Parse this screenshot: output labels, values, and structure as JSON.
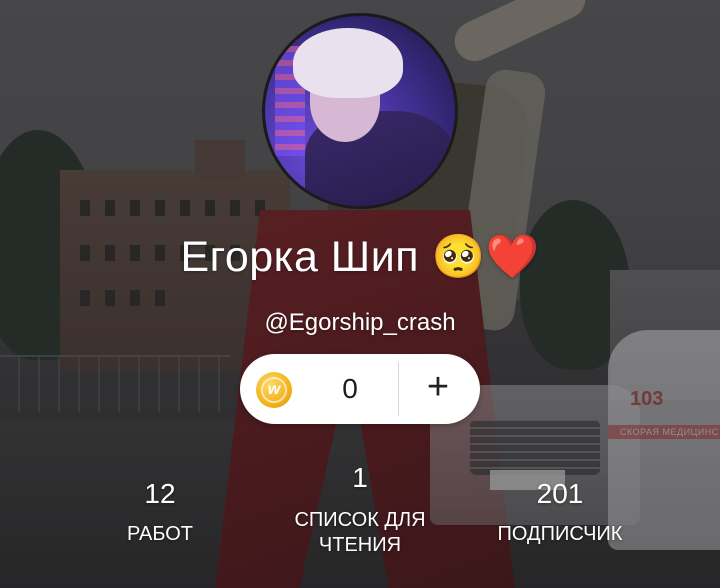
{
  "profile": {
    "display_name": "Егорка Шип 🥺❤️",
    "handle": "@Egorship_crash"
  },
  "coins": {
    "icon": "wattpad-coin-icon",
    "icon_letter": "w",
    "count": "0",
    "add_label": "+"
  },
  "stats": {
    "works": {
      "value": "12",
      "label": "РАБОТ"
    },
    "reading_lists": {
      "value": "1",
      "label": "СПИСОК ДЛЯ ЧТЕНИЯ"
    },
    "followers": {
      "value": "201",
      "label": "ПОДПИСЧИК"
    }
  },
  "background": {
    "ambulance_number": "103",
    "ambulance_text": "СКОРАЯ МЕДИЦИНС"
  },
  "colors": {
    "coin": "#f3b31c",
    "text": "#ffffff",
    "pill": "#ffffff"
  }
}
